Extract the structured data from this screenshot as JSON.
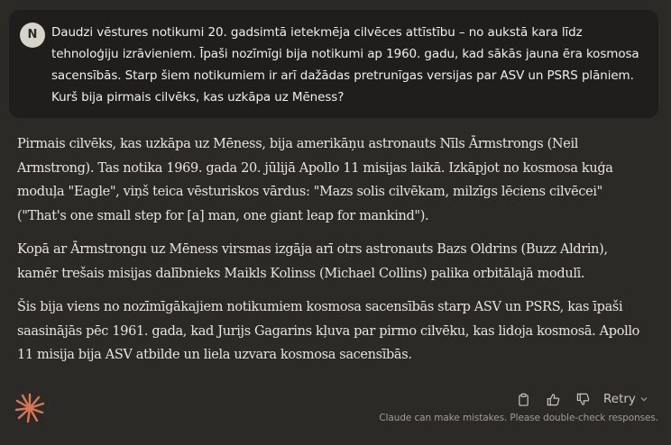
{
  "user_message": {
    "avatar_initial": "N",
    "text": "Daudzi vēstures notikumi 20. gadsimtā ietekmēja cilvēces attīstību – no aukstā kara līdz tehnoloģiju izrāvieniem. Īpaši nozīmīgi bija notikumi ap 1960. gadu, kad sākās jauna ēra kosmosa sacensībās. Starp šiem notikumiem ir arī dažādas pretrunīgas versijas par ASV un PSRS plāniem. Kurš bija pirmais cilvēks, kas uzkāpa uz Mēness?"
  },
  "assistant_message": {
    "paragraphs": [
      "Pirmais cilvēks, kas uzkāpa uz Mēness, bija amerikāņu astronauts Nīls Ārmstrongs (Neil Armstrong). Tas notika 1969. gada 20. jūlijā Apollo 11 misijas laikā. Izkāpjot no kosmosa kuģa moduļa \"Eagle\", viņš teica vēsturiskos vārdus: \"Mazs solis cilvēkam, milzīgs lēciens cilvēcei\" (\"That's one small step for [a] man, one giant leap for mankind\").",
      "Kopā ar Ārmstrongu uz Mēness virsmas izgāja arī otrs astronauts Bazs Oldrins (Buzz Aldrin), kamēr trešais misijas dalībnieks Maikls Kolinss (Michael Collins) palika orbitālajā modulī.",
      "Šis bija viens no nozīmīgākajiem notikumiem kosmosa sacensībās starp ASV un PSRS, kas īpaši saasinājās pēc 1961. gada, kad Jurijs Gagarins kļuva par pirmo cilvēku, kas lidoja kosmosā. Apollo 11 misija bija ASV atbilde un liela uzvara kosmosa sacensībās."
    ]
  },
  "actions": {
    "icons": [
      "copy-icon",
      "thumbs-up-icon",
      "thumbs-down-icon"
    ],
    "retry_label": "Retry"
  },
  "footer": {
    "disclaimer": "Claude can make mistakes. Please double-check responses."
  },
  "colors": {
    "background": "#2b2a27",
    "user_bubble": "#1f1e1c",
    "brand_accent": "#d97757",
    "text": "#e8e5de",
    "muted": "#a19d94"
  }
}
